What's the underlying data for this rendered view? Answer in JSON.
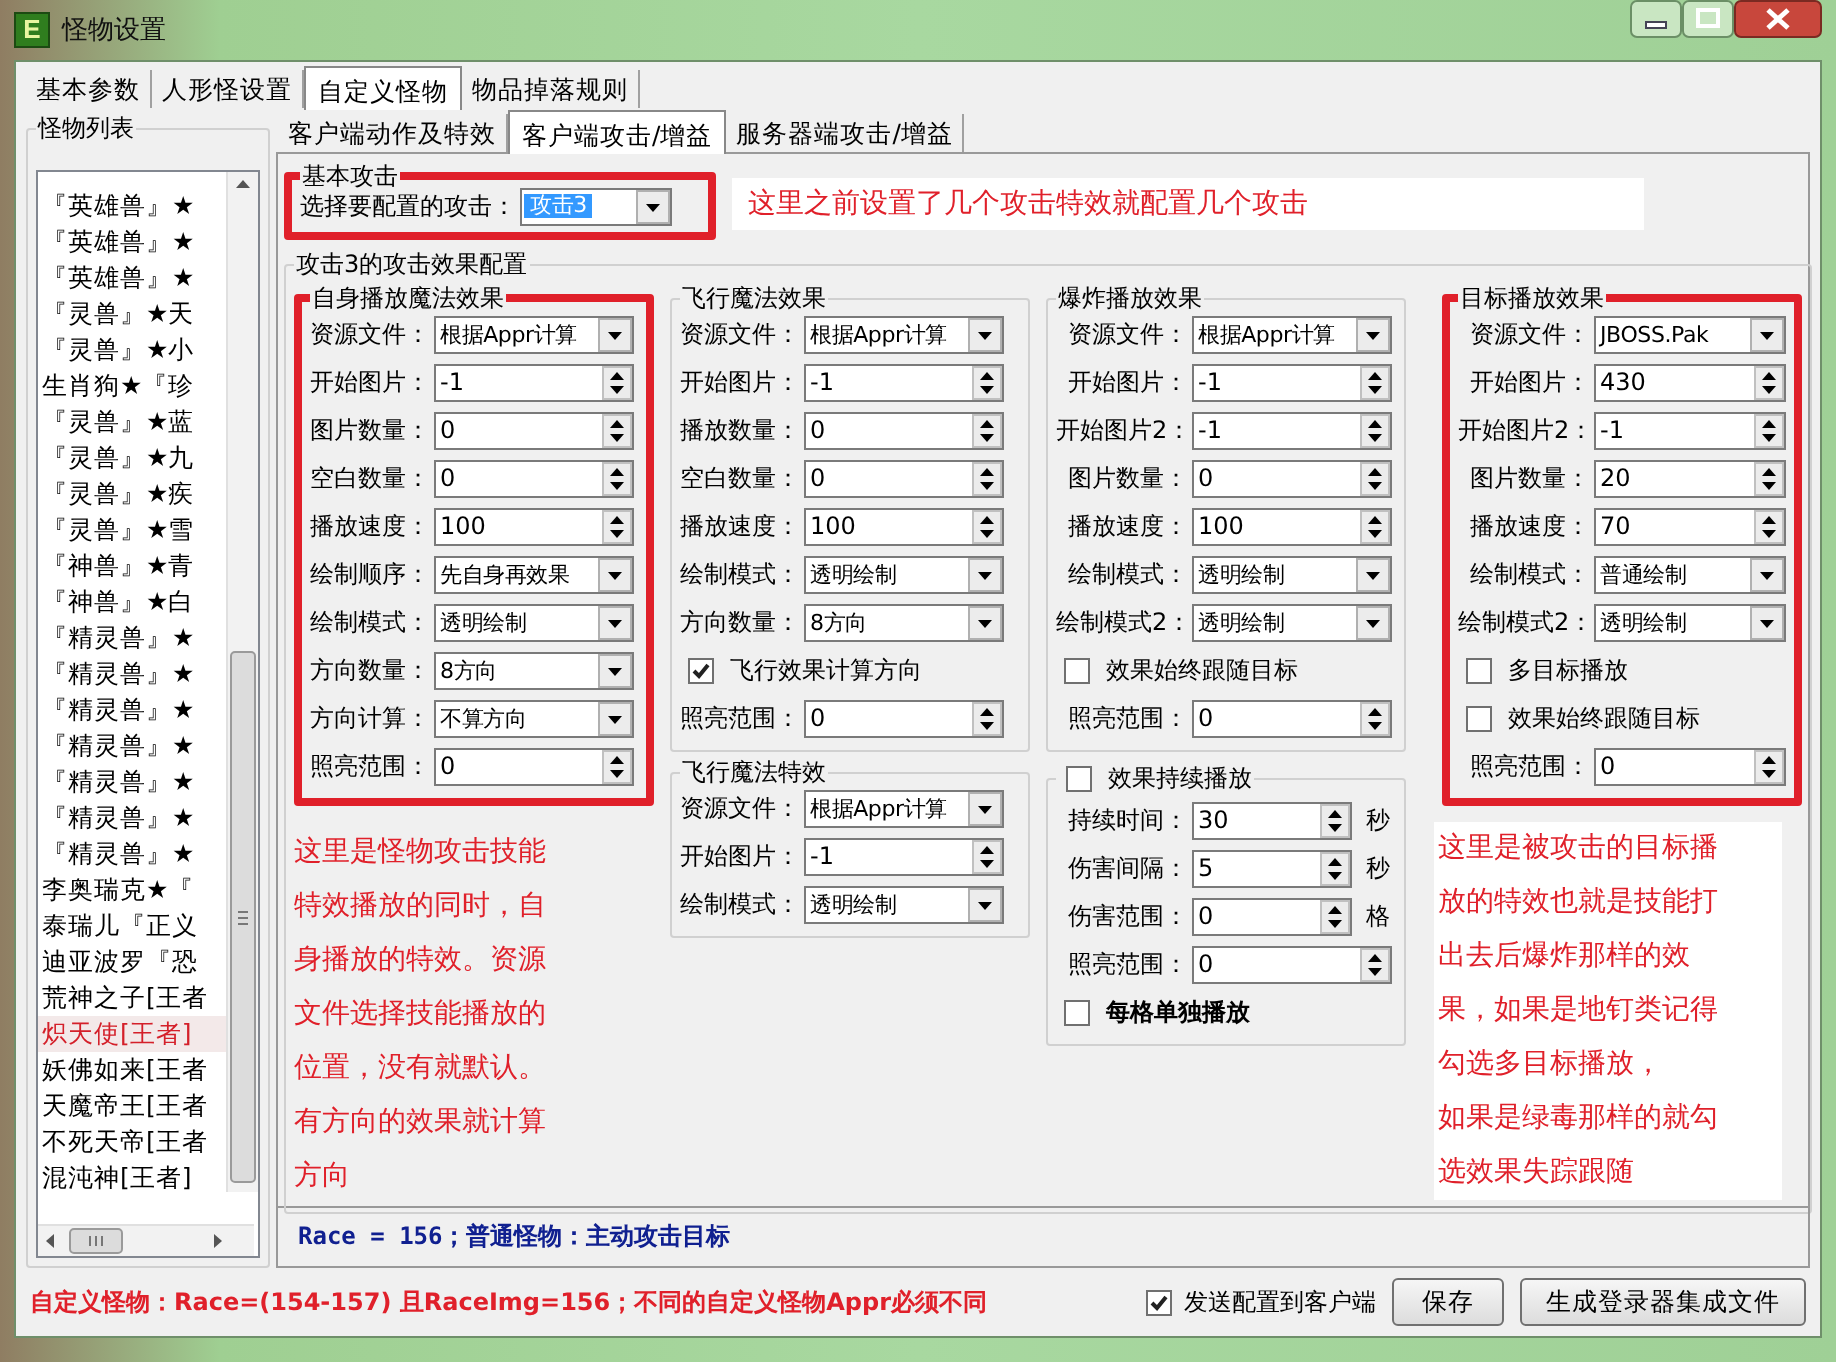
{
  "window": {
    "icon_letter": "E",
    "title": "怪物设置"
  },
  "main_tabs": [
    {
      "label": "基本参数",
      "selected": false
    },
    {
      "label": "人形怪设置",
      "selected": false
    },
    {
      "label": "自定义怪物",
      "selected": true
    },
    {
      "label": "物品掉落规则",
      "selected": false
    }
  ],
  "monster_list": {
    "title": "怪物列表",
    "items": [
      {
        "label": "『英雄兽』★",
        "selected": false
      },
      {
        "label": "『英雄兽』★",
        "selected": false
      },
      {
        "label": "『英雄兽』★",
        "selected": false
      },
      {
        "label": "『灵兽』★天",
        "selected": false
      },
      {
        "label": "『灵兽』★小",
        "selected": false
      },
      {
        "label": "生肖狗★『珍",
        "selected": false
      },
      {
        "label": "『灵兽』★蓝",
        "selected": false
      },
      {
        "label": "『灵兽』★九",
        "selected": false
      },
      {
        "label": "『灵兽』★疾",
        "selected": false
      },
      {
        "label": "『灵兽』★雪",
        "selected": false
      },
      {
        "label": "『神兽』★青",
        "selected": false
      },
      {
        "label": "『神兽』★白",
        "selected": false
      },
      {
        "label": "『精灵兽』★",
        "selected": false
      },
      {
        "label": "『精灵兽』★",
        "selected": false
      },
      {
        "label": "『精灵兽』★",
        "selected": false
      },
      {
        "label": "『精灵兽』★",
        "selected": false
      },
      {
        "label": "『精灵兽』★",
        "selected": false
      },
      {
        "label": "『精灵兽』★",
        "selected": false
      },
      {
        "label": "『精灵兽』★",
        "selected": false
      },
      {
        "label": "李奥瑞克★『",
        "selected": false
      },
      {
        "label": "泰瑞儿『正义",
        "selected": false
      },
      {
        "label": "迪亚波罗『恐",
        "selected": false
      },
      {
        "label": "荒神之子[王者",
        "selected": false
      },
      {
        "label": "炽天使[王者]",
        "selected": true
      },
      {
        "label": "妖佛如来[王者",
        "selected": false
      },
      {
        "label": "天魔帝王[王者",
        "selected": false
      },
      {
        "label": "不死天帝[王者",
        "selected": false
      },
      {
        "label": "混沌神[王者]",
        "selected": false
      }
    ]
  },
  "sub_tabs": [
    {
      "label": "客户端动作及特效",
      "selected": false
    },
    {
      "label": "客户端攻击/增益",
      "selected": true
    },
    {
      "label": "服务器端攻击/增益",
      "selected": false
    }
  ],
  "basic_attack": {
    "title": "基本攻击",
    "highlighted": true,
    "label": "选择要配置的攻击：",
    "value": "攻击3",
    "focused": true,
    "note": "这里之前设置了几个攻击特效就配置几个攻击"
  },
  "effect_config": {
    "title": "攻击3的攻击效果配置",
    "columns": [
      {
        "groups": [
          {
            "title": "自身播放魔法效果",
            "highlighted": true,
            "rows": [
              {
                "kind": "dropdown",
                "label": "资源文件：",
                "value": "根据Appr计算"
              },
              {
                "kind": "spinner",
                "label": "开始图片：",
                "value": "-1"
              },
              {
                "kind": "spinner",
                "label": "图片数量：",
                "value": "0"
              },
              {
                "kind": "spinner",
                "label": "空白数量：",
                "value": "0"
              },
              {
                "kind": "spinner",
                "label": "播放速度：",
                "value": "100"
              },
              {
                "kind": "dropdown",
                "label": "绘制顺序：",
                "value": "先自身再效果"
              },
              {
                "kind": "dropdown",
                "label": "绘制模式：",
                "value": "透明绘制"
              },
              {
                "kind": "dropdown",
                "label": "方向数量：",
                "value": "8方向"
              },
              {
                "kind": "dropdown",
                "label": "方向计算：",
                "value": "不算方向"
              },
              {
                "kind": "spinner",
                "label": "照亮范围：",
                "value": "0"
              }
            ]
          }
        ],
        "note": [
          "这里是怪物攻击技能",
          "特效播放的同时，自",
          "身播放的特效。资源",
          "文件选择技能播放的",
          "位置，没有就默认。",
          "有方向的效果就计算",
          "方向"
        ]
      },
      {
        "groups": [
          {
            "title": "飞行魔法效果",
            "highlighted": false,
            "rows": [
              {
                "kind": "dropdown",
                "label": "资源文件：",
                "value": "根据Appr计算"
              },
              {
                "kind": "spinner",
                "label": "开始图片：",
                "value": "-1"
              },
              {
                "kind": "spinner",
                "label": "播放数量：",
                "value": "0"
              },
              {
                "kind": "spinner",
                "label": "空白数量：",
                "value": "0"
              },
              {
                "kind": "spinner",
                "label": "播放速度：",
                "value": "100"
              },
              {
                "kind": "dropdown",
                "label": "绘制模式：",
                "value": "透明绘制"
              },
              {
                "kind": "dropdown",
                "label": "方向数量：",
                "value": "8方向"
              },
              {
                "kind": "checkbox",
                "label": "飞行效果计算方向",
                "checked": true
              },
              {
                "kind": "spinner",
                "label": "照亮范围：",
                "value": "0"
              }
            ]
          },
          {
            "title": "飞行魔法特效",
            "highlighted": false,
            "rows": [
              {
                "kind": "dropdown",
                "label": "资源文件：",
                "value": "根据Appr计算"
              },
              {
                "kind": "spinner",
                "label": "开始图片：",
                "value": "-1"
              },
              {
                "kind": "dropdown",
                "label": "绘制模式：",
                "value": "透明绘制"
              }
            ]
          }
        ]
      },
      {
        "groups": [
          {
            "title": "爆炸播放效果",
            "highlighted": false,
            "rows": [
              {
                "kind": "dropdown",
                "label": "资源文件：",
                "value": "根据Appr计算"
              },
              {
                "kind": "spinner",
                "label": "开始图片：",
                "value": "-1"
              },
              {
                "kind": "spinner",
                "label": "开始图片2：",
                "value": "-1"
              },
              {
                "kind": "spinner",
                "label": "图片数量：",
                "value": "0"
              },
              {
                "kind": "spinner",
                "label": "播放速度：",
                "value": "100"
              },
              {
                "kind": "dropdown",
                "label": "绘制模式：",
                "value": "透明绘制"
              },
              {
                "kind": "dropdown",
                "label": "绘制模式2：",
                "value": "透明绘制"
              },
              {
                "kind": "checkbox",
                "label": "效果始终跟随目标",
                "checked": false
              },
              {
                "kind": "spinner",
                "label": "照亮范围：",
                "value": "0"
              }
            ]
          },
          {
            "header": {
              "label": "效果持续播放",
              "checked": false
            },
            "highlighted": false,
            "rows": [
              {
                "kind": "spinner",
                "label": "持续时间：",
                "value": "30",
                "unit": "秒"
              },
              {
                "kind": "spinner",
                "label": "伤害间隔：",
                "value": "5",
                "unit": "秒"
              },
              {
                "kind": "spinner",
                "label": "伤害范围：",
                "value": "0",
                "unit": "格"
              },
              {
                "kind": "spinner",
                "label": "照亮范围：",
                "value": "0"
              },
              {
                "kind": "checkbox",
                "label": "每格单独播放",
                "checked": false,
                "bold": true
              }
            ]
          }
        ]
      },
      {
        "groups": [
          {
            "title": "目标播放效果",
            "highlighted": true,
            "rows": [
              {
                "kind": "dropdown",
                "label": "资源文件：",
                "value": "JBOSS.Pak"
              },
              {
                "kind": "spinner",
                "label": "开始图片：",
                "value": "430"
              },
              {
                "kind": "spinner",
                "label": "开始图片2：",
                "value": "-1"
              },
              {
                "kind": "spinner",
                "label": "图片数量：",
                "value": "20"
              },
              {
                "kind": "spinner",
                "label": "播放速度：",
                "value": "70"
              },
              {
                "kind": "dropdown",
                "label": "绘制模式：",
                "value": "普通绘制"
              },
              {
                "kind": "dropdown",
                "label": "绘制模式2：",
                "value": "透明绘制"
              },
              {
                "kind": "checkbox",
                "label": "多目标播放",
                "checked": false
              },
              {
                "kind": "checkbox",
                "label": "效果始终跟随目标",
                "checked": false
              },
              {
                "kind": "spinner",
                "label": "照亮范围：",
                "value": "0"
              }
            ]
          }
        ],
        "note": [
          "这里是被攻击的目标播",
          "放的特效也就是技能打",
          "出去后爆炸那样的效",
          "果，如果是地钉类记得",
          "勾选多目标播放，",
          "如果是绿毒那样的就勾",
          "选效果失踪跟随"
        ]
      }
    ]
  },
  "status_line": "Race = 156；普通怪物：主动攻击目标",
  "footer": {
    "note": "自定义怪物：Race=(154-157) 且RaceImg=156；不同的自定义怪物Appr必须不同",
    "send_option": {
      "label": "发送配置到客户端",
      "checked": true
    },
    "buttons": [
      "保存",
      "生成登录器集成文件"
    ]
  }
}
